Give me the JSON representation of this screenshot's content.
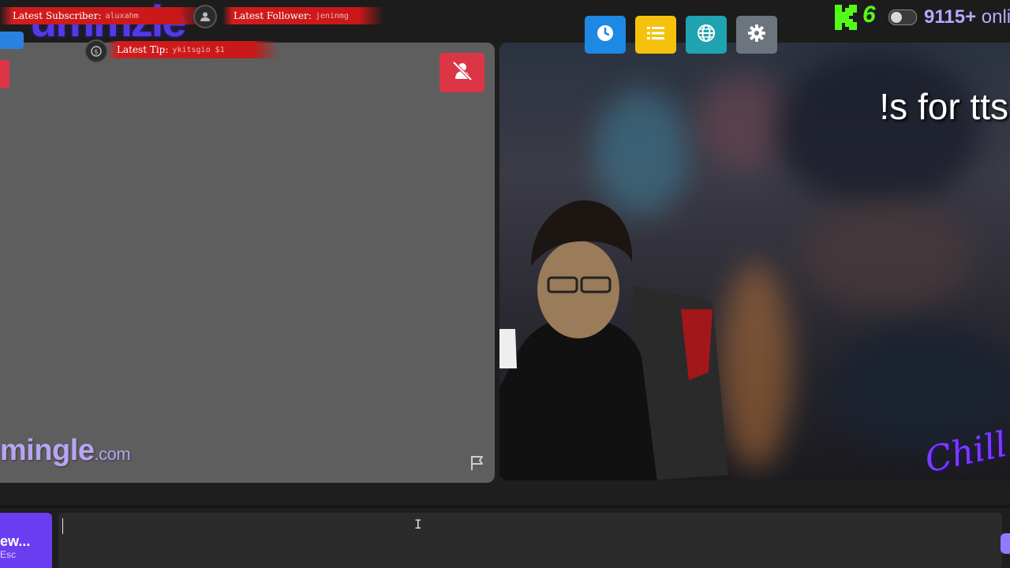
{
  "overlay": {
    "stream_logo": "ummzie",
    "latest_subscriber_label": "Latest Subscriber:",
    "latest_subscriber_value": "aluxahm",
    "latest_follower_label": "Latest Follower:",
    "latest_follower_value": "jeninmg",
    "latest_tip_label": "Latest Tip:",
    "latest_tip_value": "ykitsgio $1"
  },
  "left_panel": {
    "logo_text": "mingle",
    "logo_suffix": ".com"
  },
  "right_panel": {
    "tts_text": "!s for tts",
    "chill_logo": "Chill"
  },
  "status": {
    "kick_count": "6",
    "online_count": "9115+",
    "online_label": " onli"
  },
  "bottom": {
    "skip_label": "ew...",
    "skip_hint": "Esc",
    "chat_value": ""
  },
  "colors": {
    "mute_red": "#dc3545",
    "history_blue": "#1e88e5",
    "list_yellow": "#f4c20d",
    "globe_teal": "#1fa3b0",
    "settings_gray": "#6c757d",
    "kick_green": "#53fc18",
    "skip_purple": "#6b3df0"
  }
}
